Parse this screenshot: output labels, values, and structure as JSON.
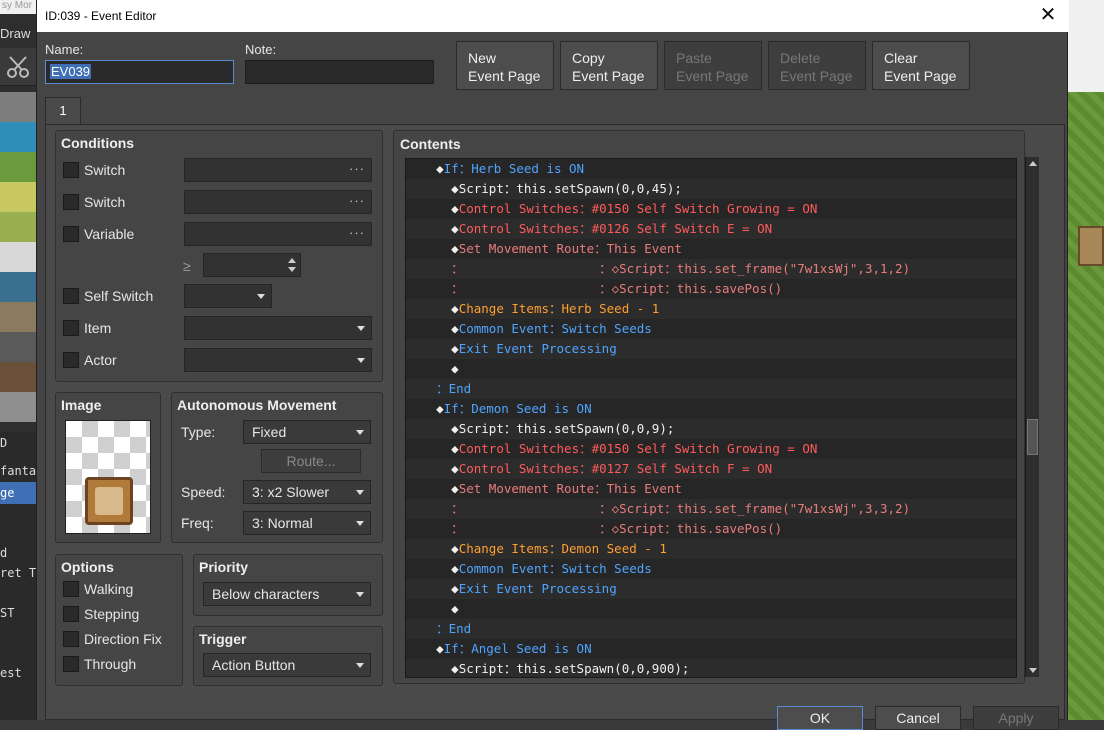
{
  "background": {
    "left_title_fragment": "sy Mor",
    "left_draw_label": "Draw",
    "left_list": [
      {
        "label": "D",
        "selected": false
      },
      {
        "label": "fanta",
        "selected": false
      },
      {
        "label": "ge",
        "selected": true
      },
      {
        "label": "d",
        "selected": false
      },
      {
        "label": "ret T",
        "selected": false
      },
      {
        "label": "ST",
        "selected": false
      },
      {
        "label": "est",
        "selected": false
      }
    ]
  },
  "window": {
    "title": "ID:039 - Event Editor",
    "close_glyph": "✕"
  },
  "header": {
    "name_label": "Name:",
    "name_value": "EV039",
    "note_label": "Note:",
    "note_value": "",
    "buttons": [
      {
        "line1": "New",
        "line2": "Event Page",
        "enabled": true
      },
      {
        "line1": "Copy",
        "line2": "Event Page",
        "enabled": true
      },
      {
        "line1": "Paste",
        "line2": "Event Page",
        "enabled": false
      },
      {
        "line1": "Delete",
        "line2": "Event Page",
        "enabled": false
      },
      {
        "line1": "Clear",
        "line2": "Event Page",
        "enabled": true
      }
    ]
  },
  "tabs": [
    {
      "label": "1"
    }
  ],
  "conditions": {
    "title": "Conditions",
    "rows": [
      {
        "label": "Switch",
        "value": "",
        "control": "dots"
      },
      {
        "label": "Switch",
        "value": "",
        "control": "dots"
      },
      {
        "label": "Variable",
        "value": "",
        "control": "dots"
      },
      {
        "label": "Self Switch",
        "value": "",
        "control": "dropdown"
      },
      {
        "label": "Item",
        "value": "",
        "control": "dropdown"
      },
      {
        "label": "Actor",
        "value": "",
        "control": "dropdown"
      }
    ],
    "variable_operator": "≥",
    "variable_number": ""
  },
  "image": {
    "title": "Image"
  },
  "autonomous_movement": {
    "title": "Autonomous Movement",
    "type_label": "Type:",
    "type_value": "Fixed",
    "route_button": "Route...",
    "speed_label": "Speed:",
    "speed_value": "3: x2 Slower",
    "freq_label": "Freq:",
    "freq_value": "3: Normal"
  },
  "options": {
    "title": "Options",
    "items": [
      "Walking",
      "Stepping",
      "Direction Fix",
      "Through"
    ]
  },
  "priority": {
    "title": "Priority",
    "value": "Below characters"
  },
  "trigger": {
    "title": "Trigger",
    "value": "Action Button"
  },
  "contents": {
    "title": "Contents",
    "lines": [
      {
        "indent": "    ",
        "parts": [
          {
            "t": "◆",
            "c": "white"
          },
          {
            "t": "If：Herb Seed is ON",
            "c": "blue"
          }
        ]
      },
      {
        "indent": "      ",
        "parts": [
          {
            "t": "◆",
            "c": "white"
          },
          {
            "t": "Script：this.setSpawn(0,0,45);",
            "c": "white"
          }
        ]
      },
      {
        "indent": "      ",
        "parts": [
          {
            "t": "◆",
            "c": "white"
          },
          {
            "t": "Control Switches：#0150 Self Switch Growing = ON",
            "c": "red"
          }
        ]
      },
      {
        "indent": "      ",
        "parts": [
          {
            "t": "◆",
            "c": "white"
          },
          {
            "t": "Control Switches：#0126 Self Switch E = ON",
            "c": "red"
          }
        ]
      },
      {
        "indent": "      ",
        "parts": [
          {
            "t": "◆",
            "c": "white"
          },
          {
            "t": "Set Movement Route：This Event",
            "c": "pink"
          }
        ]
      },
      {
        "indent": "      ",
        "parts": [
          {
            "t": "：                  ：◇Script：this.set_frame(\"7w1xsWj\",3,1,2)",
            "c": "pink"
          }
        ]
      },
      {
        "indent": "      ",
        "parts": [
          {
            "t": "：                  ：◇Script：this.savePos()",
            "c": "pink"
          }
        ]
      },
      {
        "indent": "      ",
        "parts": [
          {
            "t": "◆",
            "c": "white"
          },
          {
            "t": "Change Items：Herb Seed - 1",
            "c": "orange"
          }
        ]
      },
      {
        "indent": "      ",
        "parts": [
          {
            "t": "◆",
            "c": "white"
          },
          {
            "t": "Common Event：Switch Seeds",
            "c": "blue"
          }
        ]
      },
      {
        "indent": "      ",
        "parts": [
          {
            "t": "◆",
            "c": "white"
          },
          {
            "t": "Exit Event Processing",
            "c": "blue"
          }
        ]
      },
      {
        "indent": "      ",
        "parts": [
          {
            "t": "◆",
            "c": "white"
          }
        ]
      },
      {
        "indent": "    ",
        "parts": [
          {
            "t": "：End",
            "c": "blue"
          }
        ]
      },
      {
        "indent": "    ",
        "parts": [
          {
            "t": "◆",
            "c": "white"
          },
          {
            "t": "If：Demon Seed is ON",
            "c": "blue"
          }
        ]
      },
      {
        "indent": "      ",
        "parts": [
          {
            "t": "◆",
            "c": "white"
          },
          {
            "t": "Script：this.setSpawn(0,0,9);",
            "c": "white"
          }
        ]
      },
      {
        "indent": "      ",
        "parts": [
          {
            "t": "◆",
            "c": "white"
          },
          {
            "t": "Control Switches：#0150 Self Switch Growing = ON",
            "c": "red"
          }
        ]
      },
      {
        "indent": "      ",
        "parts": [
          {
            "t": "◆",
            "c": "white"
          },
          {
            "t": "Control Switches：#0127 Self Switch F = ON",
            "c": "red"
          }
        ]
      },
      {
        "indent": "      ",
        "parts": [
          {
            "t": "◆",
            "c": "white"
          },
          {
            "t": "Set Movement Route：This Event",
            "c": "pink"
          }
        ]
      },
      {
        "indent": "      ",
        "parts": [
          {
            "t": "：                  ：◇Script：this.set_frame(\"7w1xsWj\",3,3,2)",
            "c": "pink"
          }
        ]
      },
      {
        "indent": "      ",
        "parts": [
          {
            "t": "：                  ：◇Script：this.savePos()",
            "c": "pink"
          }
        ]
      },
      {
        "indent": "      ",
        "parts": [
          {
            "t": "◆",
            "c": "white"
          },
          {
            "t": "Change Items：Demon Seed - 1",
            "c": "orange"
          }
        ]
      },
      {
        "indent": "      ",
        "parts": [
          {
            "t": "◆",
            "c": "white"
          },
          {
            "t": "Common Event：Switch Seeds",
            "c": "blue"
          }
        ]
      },
      {
        "indent": "      ",
        "parts": [
          {
            "t": "◆",
            "c": "white"
          },
          {
            "t": "Exit Event Processing",
            "c": "blue"
          }
        ]
      },
      {
        "indent": "      ",
        "parts": [
          {
            "t": "◆",
            "c": "white"
          }
        ]
      },
      {
        "indent": "    ",
        "parts": [
          {
            "t": "：End",
            "c": "blue"
          }
        ]
      },
      {
        "indent": "    ",
        "parts": [
          {
            "t": "◆",
            "c": "white"
          },
          {
            "t": "If：Angel Seed is ON",
            "c": "blue"
          }
        ]
      },
      {
        "indent": "      ",
        "parts": [
          {
            "t": "◆",
            "c": "white"
          },
          {
            "t": "Script：this.setSpawn(0,0,900);",
            "c": "white"
          }
        ]
      }
    ]
  },
  "footer": {
    "ok": "OK",
    "cancel": "Cancel",
    "apply": "Apply"
  },
  "colors": {
    "accent": "#3f6fb5",
    "blue_text": "#4fa3ff",
    "red_text": "#ff5b5b",
    "orange_text": "#ff9f2f",
    "pink_text": "#e87c7c"
  }
}
